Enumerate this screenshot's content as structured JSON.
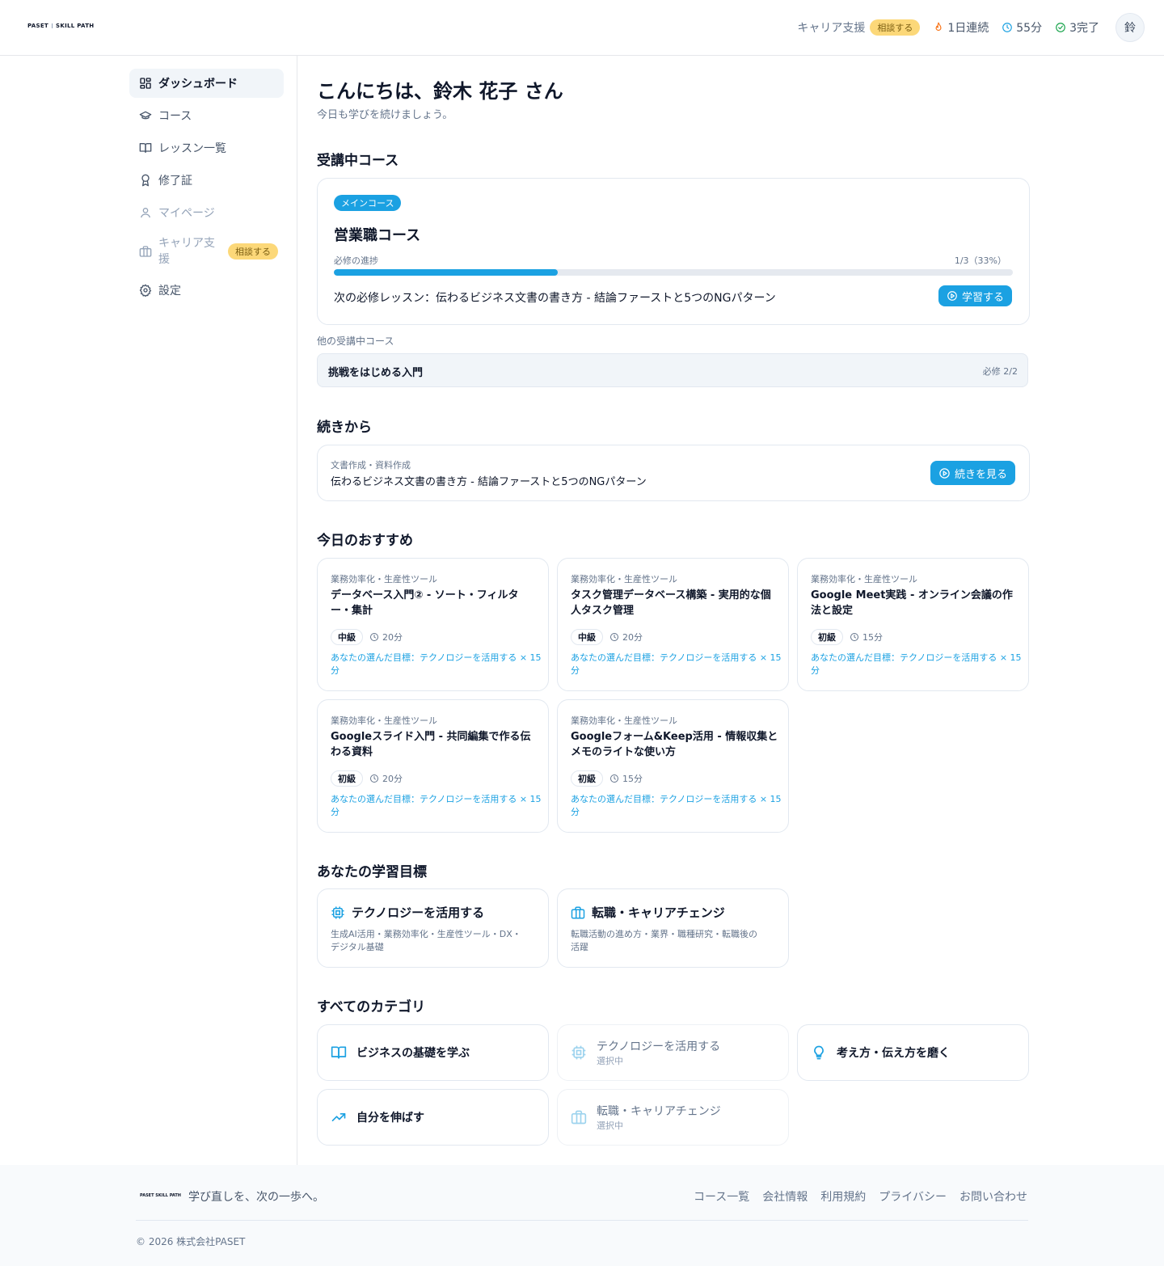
{
  "header": {
    "logo_left": "PASET",
    "logo_right": "SKILL PATH",
    "career_label": "キャリア支援",
    "consult_badge": "相談する",
    "streak": "1日連続",
    "minutes": "55分",
    "completed": "3完了",
    "avatar_initial": "鈴"
  },
  "sidebar": {
    "items": [
      {
        "label": "ダッシュボード",
        "icon": "dashboard-icon"
      },
      {
        "label": "コース",
        "icon": "graduation-cap-icon"
      },
      {
        "label": "レッスン一覧",
        "icon": "book-open-icon"
      },
      {
        "label": "修了証",
        "icon": "award-icon"
      },
      {
        "label": "マイページ",
        "icon": "user-icon"
      },
      {
        "label": "キャリア支援",
        "badge": "相談する",
        "icon": "briefcase-icon"
      },
      {
        "label": "設定",
        "icon": "gear-icon"
      }
    ]
  },
  "main": {
    "greeting": "こんにちは、鈴木 花子 さん",
    "subgreeting": "今日も学びを続けましょう。",
    "enrolled": {
      "title": "受講中コース",
      "badge": "メインコース",
      "course_name": "営業職コース",
      "progress_label": "必修の進捗",
      "progress_text": "1/3（33%）",
      "progress_fraction": 0.33,
      "next_lesson": "次の必修レッスン：伝わるビジネス文書の書き方 - 結論ファーストと5つのNGパターン",
      "study_button": "学習する",
      "other_label": "他の受講中コース",
      "other_course_name": "挑戦をはじめる入門",
      "other_course_req": "必修 2/2"
    },
    "continue": {
      "title": "続きから",
      "category": "文書作成・資料作成",
      "lesson": "伝わるビジネス文書の書き方 - 結論ファーストと5つのNGパターン",
      "button": "続きを見る"
    },
    "recommend": {
      "title": "今日のおすすめ",
      "items": [
        {
          "category": "業務効率化・生産性ツール",
          "title": "データベース入門② - ソート・フィルター・集計",
          "level": "中級",
          "duration": "20分",
          "goal": "あなたの選んだ目標：テクノロジーを活用する × 15分"
        },
        {
          "category": "業務効率化・生産性ツール",
          "title": "タスク管理データベース構築 - 実用的な個人タスク管理",
          "level": "中級",
          "duration": "20分",
          "goal": "あなたの選んだ目標：テクノロジーを活用する × 15分"
        },
        {
          "category": "業務効率化・生産性ツール",
          "title": "Google Meet実践 - オンライン会議の作法と設定",
          "level": "初級",
          "duration": "15分",
          "goal": "あなたの選んだ目標：テクノロジーを活用する × 15分"
        },
        {
          "category": "業務効率化・生産性ツール",
          "title": "Googleスライド入門 - 共同編集で作る伝わる資料",
          "level": "初級",
          "duration": "20分",
          "goal": "あなたの選んだ目標：テクノロジーを活用する × 15分"
        },
        {
          "category": "業務効率化・生産性ツール",
          "title": "Googleフォーム&Keep活用 - 情報収集とメモのライトな使い方",
          "level": "初級",
          "duration": "15分",
          "goal": "あなたの選んだ目標：テクノロジーを活用する × 15分"
        }
      ]
    },
    "goals": {
      "title": "あなたの学習目標",
      "items": [
        {
          "name": "テクノロジーを活用する",
          "desc": "生成AI活用・業務効率化・生産性ツール・DX・デジタル基礎",
          "icon": "cpu-icon"
        },
        {
          "name": "転職・キャリアチェンジ",
          "desc": "転職活動の進め方・業界・職種研究・転職後の活躍",
          "icon": "briefcase-icon"
        }
      ]
    },
    "categories": {
      "title": "すべてのカテゴリ",
      "items": [
        {
          "name": "ビジネスの基礎を学ぶ",
          "sub": "",
          "icon": "book-open-icon"
        },
        {
          "name": "テクノロジーを活用する",
          "sub": "選択中",
          "icon": "cpu-icon"
        },
        {
          "name": "考え方・伝え方を磨く",
          "sub": "",
          "icon": "lightbulb-icon"
        },
        {
          "name": "自分を伸ばす",
          "sub": "",
          "icon": "trending-up-icon"
        },
        {
          "name": "転職・キャリアチェンジ",
          "sub": "選択中",
          "icon": "briefcase-icon"
        }
      ]
    }
  },
  "footer": {
    "logo_left": "PASET",
    "logo_right": "SKILL PATH",
    "tagline": "学び直しを、次の一歩へ。",
    "links": [
      "コース一覧",
      "会社情報",
      "利用規約",
      "プライバシー",
      "お問い合わせ"
    ],
    "copyright": "© 2026 株式会社PASET"
  },
  "colors": {
    "accent": "#1ba1e2",
    "badge_yellow": "#fcd879",
    "streak_orange": "#f97316",
    "check_green": "#16a34a"
  }
}
